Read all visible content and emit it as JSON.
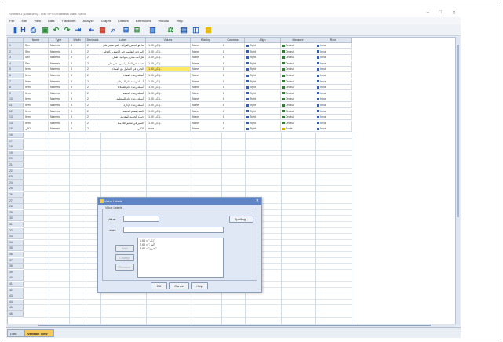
{
  "window": {
    "title": "*Untitled1 [DataSet0] - IBM SPSS Statistics Data Editor",
    "min": "–",
    "max": "□",
    "close": "✕"
  },
  "menu": [
    "File",
    "Edit",
    "View",
    "Data",
    "Transform",
    "Analyze",
    "Graphs",
    "Utilities",
    "Extensions",
    "Window",
    "Help"
  ],
  "toolbar": {
    "icons": [
      "open-icon",
      "save-icon",
      "print-icon",
      "dialog-recall-icon",
      "undo-icon",
      "redo-icon",
      "goto-case-icon",
      "goto-variable-icon",
      "variables-icon",
      "find-icon",
      "insert-cases-icon",
      "insert-variable-icon",
      "split-file-icon",
      "weight-cases-icon",
      "select-cases-icon",
      "value-labels-icon",
      "use-sets-icon"
    ],
    "colors": {
      "accent": "#1f5fbf",
      "green": "#2e8b3a",
      "red": "#d03a2a",
      "yellow": "#e8b400"
    }
  },
  "grid": {
    "columns": [
      "Name",
      "Type",
      "Width",
      "Decimals",
      "Label",
      "Values",
      "Missing",
      "Columns",
      "Align",
      "Measure",
      "Role"
    ],
    "rows": [
      [
        "Sex",
        "Numeric",
        "8",
        "2",
        "ما هو الجنس المرأة... ليس مجبر على",
        "{1.00, ذكر}...",
        "None",
        "8",
        "Right",
        "Ordinal",
        "Input"
      ],
      [
        "Sex",
        "Numeric",
        "8",
        "2",
        "المرحلة التعليمية في الكشف والتحليل",
        "{1.00, ذكر}...",
        "None",
        "8",
        "Right",
        "Ordinal",
        "Input"
      ],
      [
        "Sex",
        "Numeric",
        "8",
        "2",
        "هل أنت ملتزم بمواعيد العمل",
        "{1.00, ذكر}...",
        "None",
        "8",
        "Right",
        "Ordinal",
        "Input"
      ],
      [
        "Sex",
        "Numeric",
        "8",
        "2",
        "حديث في التعليم ليس مجبر على",
        "{1.00, ذكر}...",
        "None",
        "8",
        "Right",
        "Ordinal",
        "Input"
      ],
      [
        "Item",
        "Numeric",
        "8",
        "2",
        "الخبرة في التعامل مع العملاء",
        "{1.00, ذكر}...",
        "None",
        "8",
        "Right",
        "Ordinal",
        "Input"
      ],
      [
        "Item",
        "Numeric",
        "8",
        "2",
        "أسئلة رضاء العملاء",
        "{1.00, ذكر}...",
        "None",
        "8",
        "Right",
        "Ordinal",
        "Input"
      ],
      [
        "Item",
        "Numeric",
        "8",
        "2",
        "أسئلة رضاء عام الموظف",
        "{1.00, ذكر}...",
        "None",
        "8",
        "Right",
        "Ordinal",
        "Input"
      ],
      [
        "Item",
        "Numeric",
        "8",
        "2",
        "أسئلة رضاء عام للعملاء",
        "{1.00, ذكر}...",
        "None",
        "8",
        "Right",
        "Ordinal",
        "Input"
      ],
      [
        "Item",
        "Numeric",
        "8",
        "2",
        "أسئلة رضاء الخدمة",
        "{1.00, ذكر}...",
        "None",
        "8",
        "Right",
        "Ordinal",
        "Input"
      ],
      [
        "Item",
        "Numeric",
        "8",
        "2",
        "أسئلة رضاء عام للمنظمة",
        "{1.00, ذكر}...",
        "None",
        "8",
        "Right",
        "Ordinal",
        "Input"
      ],
      [
        "Item",
        "Numeric",
        "8",
        "2",
        "أسئلة رضاء الإدارة",
        "{1.00, ذكر}...",
        "None",
        "8",
        "Right",
        "Ordinal",
        "Input"
      ],
      [
        "Item",
        "Numeric",
        "8",
        "2",
        "الثقة بمقدم الخدمة",
        "{1.00, ذكر}...",
        "None",
        "8",
        "Right",
        "Ordinal",
        "Input"
      ],
      [
        "Item",
        "Numeric",
        "8",
        "2",
        "جودة الخدمة المقدمة",
        "{1.00, ذكر}...",
        "None",
        "8",
        "Right",
        "Ordinal",
        "Input"
      ],
      [
        "Item",
        "Numeric",
        "8",
        "2",
        "التميز في تقديم الخدمة",
        "{1.00, ذكر}...",
        "None",
        "8",
        "Right",
        "Ordinal",
        "Input"
      ],
      [
        "الكلي",
        "Numeric",
        "8",
        "2",
        "الكلي",
        "None",
        "None",
        "8",
        "Right",
        "Scale",
        "Input"
      ]
    ],
    "highlight": {
      "row": 4,
      "col": 5
    }
  },
  "tabs": {
    "data_view": "Data View",
    "variable_view": "Variable View"
  },
  "dialog": {
    "title": "Value Labels",
    "group_legend": "Value Labels",
    "value_label": "Value:",
    "label_label": "Label:",
    "spelling": "Spelling...",
    "add": "Add",
    "change": "Change",
    "remove": "Remove",
    "list": [
      "1.00 = \"ذكر\"",
      "2.00 = \"أنثى\"",
      "3.00 = \"أخرى\""
    ],
    "ok": "OK",
    "cancel": "Cancel",
    "help": "Help"
  }
}
